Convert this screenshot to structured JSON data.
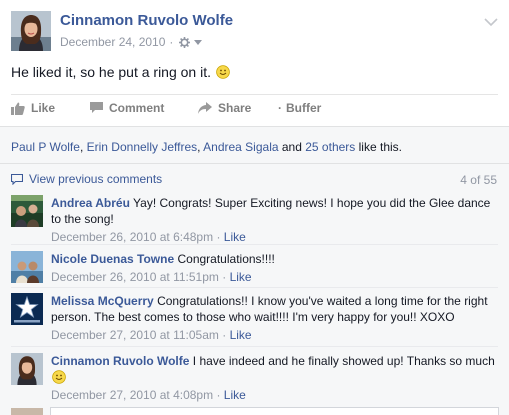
{
  "post": {
    "author": "Cinnamon Ruvolo Wolfe",
    "date": "December 24, 2010",
    "separator": "·",
    "status_text": "He liked it, so he put a ring on it.",
    "actions": {
      "like": "Like",
      "comment": "Comment",
      "share": "Share",
      "buffer_dot": "·",
      "buffer": "Buffer"
    }
  },
  "likes": {
    "names": [
      "Paul P Wolfe",
      "Erin Donnelly Jeffres",
      "Andrea Sigala"
    ],
    "comma": ",",
    "and": "and",
    "others": "25 others",
    "suffix": "like this."
  },
  "comments_header": {
    "view_previous": "View previous comments",
    "count": "4 of 55"
  },
  "comments": [
    {
      "name": "Andrea Abréu",
      "text": "Yay! Congrats! Super Exciting news! I hope you did the Glee dance to the song!",
      "time": "December 26, 2010 at 6:48pm",
      "dot": "·",
      "like": "Like"
    },
    {
      "name": "Nicole Duenas Towne",
      "text": "Congratulations!!!!",
      "time": "December 26, 2010 at 11:51pm",
      "dot": "·",
      "like": "Like"
    },
    {
      "name": "Melissa McQuerry",
      "text": "Congratulations!! I know you've waited a long time for the right person. The best comes to those who wait!!!! I'm very happy for you!! XOXO",
      "time": "December 27, 2010 at 11:05am",
      "dot": "·",
      "like": "Like"
    },
    {
      "name": "Cinnamon Ruvolo Wolfe",
      "text": "I have indeed and he finally showed up! Thanks so much",
      "time": "December 27, 2010 at 4:08pm",
      "dot": "·",
      "like": "Like"
    }
  ],
  "colors": {
    "link": "#3b5998",
    "meta": "#9197a3",
    "feedback_bg": "#f6f7f8"
  },
  "icons": {
    "chevron": "chevron-down-icon",
    "gear": "gear-icon",
    "like": "thumbs-up-icon",
    "comment": "comment-bubble-icon",
    "share": "share-arrow-icon",
    "view_previous": "comment-bubble-icon",
    "smile": "smiley-emoji-icon"
  }
}
